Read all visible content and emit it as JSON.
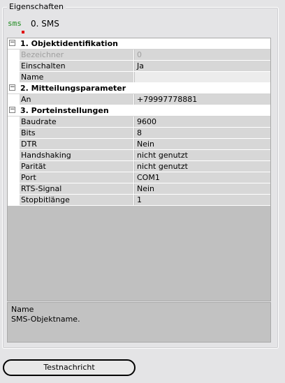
{
  "panel": {
    "title": "Eigenschaften"
  },
  "object": {
    "icon_text": "sms",
    "icon": "sms-icon",
    "title": "0. SMS"
  },
  "categories": [
    {
      "label": "1. Objektidentifikation",
      "properties": [
        {
          "name": "Bezeichner",
          "value": "0"
        },
        {
          "name": "Einschalten",
          "value": "Ja"
        },
        {
          "name": "Name",
          "value": ""
        }
      ]
    },
    {
      "label": "2. Mitteilungsparameter",
      "properties": [
        {
          "name": "An",
          "value": "+79997778881"
        }
      ]
    },
    {
      "label": "3. Porteinstellungen",
      "properties": [
        {
          "name": "Baudrate",
          "value": "9600"
        },
        {
          "name": "Bits",
          "value": "8"
        },
        {
          "name": "DTR",
          "value": "Nein"
        },
        {
          "name": "Handshaking",
          "value": "nicht genutzt"
        },
        {
          "name": "Parität",
          "value": "nicht genutzt"
        },
        {
          "name": "Port",
          "value": "COM1"
        },
        {
          "name": "RTS-Signal",
          "value": "Nein"
        },
        {
          "name": "Stopbitlänge",
          "value": "1"
        }
      ]
    }
  ],
  "description": {
    "title": "Name",
    "text": "SMS-Objektname."
  },
  "buttons": {
    "test_label": "Testnachricht"
  },
  "colors": {
    "icon_green": "#1e8a1e",
    "icon_red": "#e00000",
    "grid_bg": "#c0c0c0",
    "row_bg": "#d7d7d7"
  }
}
